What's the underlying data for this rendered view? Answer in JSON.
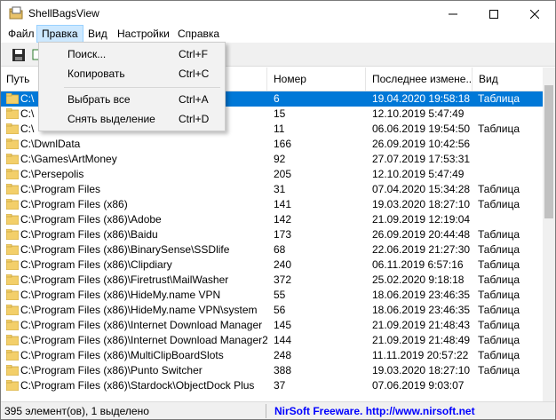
{
  "window": {
    "title": "ShellBagsView"
  },
  "menu": [
    "Файл",
    "Правка",
    "Вид",
    "Настройки",
    "Справка"
  ],
  "dropdown": [
    {
      "label": "Поиск...",
      "shortcut": "Ctrl+F"
    },
    {
      "label": "Копировать",
      "shortcut": "Ctrl+C"
    },
    {
      "label": "Выбрать все",
      "shortcut": "Ctrl+A"
    },
    {
      "label": "Снять выделение",
      "shortcut": "Ctrl+D"
    }
  ],
  "columns": [
    "Путь",
    "Номер",
    "Последнее измене...",
    "Вид"
  ],
  "rows": [
    {
      "path": "C:\\",
      "num": "6",
      "date": "19.04.2020 19:58:18",
      "type": "Таблица",
      "selected": true
    },
    {
      "path": "C:\\",
      "num": "15",
      "date": "12.10.2019 5:47:49",
      "type": ""
    },
    {
      "path": "C:\\",
      "num": "11",
      "date": "06.06.2019 19:54:50",
      "type": "Таблица"
    },
    {
      "path": "C:\\DwnlData",
      "num": "166",
      "date": "26.09.2019 10:42:56",
      "type": ""
    },
    {
      "path": "C:\\Games\\ArtMoney",
      "num": "92",
      "date": "27.07.2019 17:53:31",
      "type": ""
    },
    {
      "path": "C:\\Persepolis",
      "num": "205",
      "date": "12.10.2019 5:47:49",
      "type": ""
    },
    {
      "path": "C:\\Program Files",
      "num": "31",
      "date": "07.04.2020 15:34:28",
      "type": "Таблица"
    },
    {
      "path": "C:\\Program Files (x86)",
      "num": "141",
      "date": "19.03.2020 18:27:10",
      "type": "Таблица"
    },
    {
      "path": "C:\\Program Files (x86)\\Adobe",
      "num": "142",
      "date": "21.09.2019 12:19:04",
      "type": ""
    },
    {
      "path": "C:\\Program Files (x86)\\Baidu",
      "num": "173",
      "date": "26.09.2019 20:44:48",
      "type": "Таблица"
    },
    {
      "path": "C:\\Program Files (x86)\\BinarySense\\SSDlife",
      "num": "68",
      "date": "22.06.2019 21:27:30",
      "type": "Таблица"
    },
    {
      "path": "C:\\Program Files (x86)\\Clipdiary",
      "num": "240",
      "date": "06.11.2019 6:57:16",
      "type": "Таблица"
    },
    {
      "path": "C:\\Program Files (x86)\\Firetrust\\MailWasher",
      "num": "372",
      "date": "25.02.2020 9:18:18",
      "type": "Таблица"
    },
    {
      "path": "C:\\Program Files (x86)\\HideMy.name VPN",
      "num": "55",
      "date": "18.06.2019 23:46:35",
      "type": "Таблица"
    },
    {
      "path": "C:\\Program Files (x86)\\HideMy.name VPN\\system",
      "num": "56",
      "date": "18.06.2019 23:46:35",
      "type": "Таблица"
    },
    {
      "path": "C:\\Program Files (x86)\\Internet Download Manager",
      "num": "145",
      "date": "21.09.2019 21:48:43",
      "type": "Таблица"
    },
    {
      "path": "C:\\Program Files (x86)\\Internet Download Manager2",
      "num": "144",
      "date": "21.09.2019 21:48:49",
      "type": "Таблица"
    },
    {
      "path": "C:\\Program Files (x86)\\MultiClipBoardSlots",
      "num": "248",
      "date": "11.11.2019 20:57:22",
      "type": "Таблица"
    },
    {
      "path": "C:\\Program Files (x86)\\Punto Switcher",
      "num": "388",
      "date": "19.03.2020 18:27:10",
      "type": "Таблица"
    },
    {
      "path": "C:\\Program Files (x86)\\Stardock\\ObjectDock Plus",
      "num": "37",
      "date": "07.06.2019 9:03:07",
      "type": ""
    }
  ],
  "status": {
    "count": "395 элемент(ов), 1 выделено",
    "credit": "NirSoft Freeware.  http://www.nirsoft.net"
  }
}
